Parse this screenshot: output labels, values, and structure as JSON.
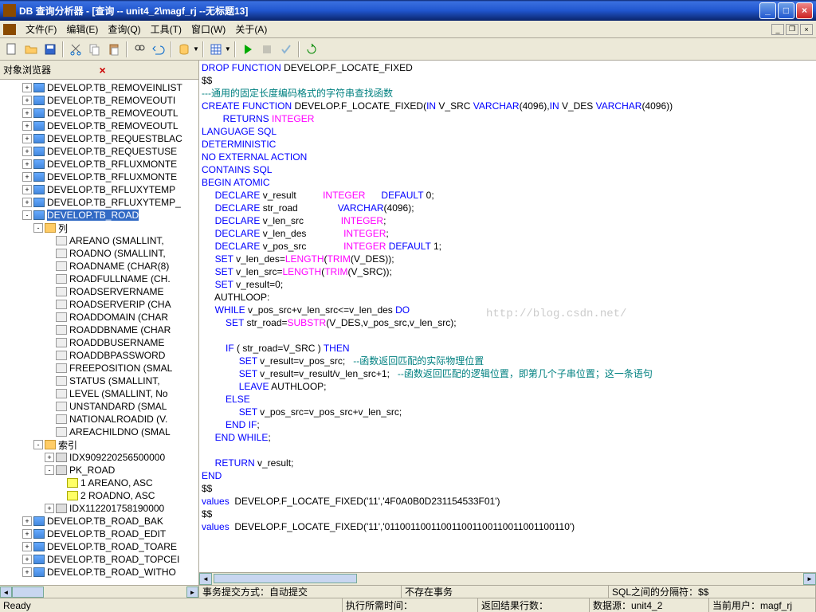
{
  "window": {
    "title": "DB 查询分析器 - [查询 -- unit4_2\\magf_rj  --无标题13]"
  },
  "menu": {
    "file": "文件(F)",
    "edit": "编辑(E)",
    "query": "查询(Q)",
    "tools": "工具(T)",
    "window": "窗口(W)",
    "help": "关于(A)"
  },
  "sidebar": {
    "title": "对象浏览器",
    "nodes": [
      {
        "l": 2,
        "e": "+",
        "i": "table",
        "t": "DEVELOP.TB_REMOVEINLIST"
      },
      {
        "l": 2,
        "e": "+",
        "i": "table",
        "t": "DEVELOP.TB_REMOVEOUTI"
      },
      {
        "l": 2,
        "e": "+",
        "i": "table",
        "t": "DEVELOP.TB_REMOVEOUTL"
      },
      {
        "l": 2,
        "e": "+",
        "i": "table",
        "t": "DEVELOP.TB_REMOVEOUTL"
      },
      {
        "l": 2,
        "e": "+",
        "i": "table",
        "t": "DEVELOP.TB_REQUESTBLAC"
      },
      {
        "l": 2,
        "e": "+",
        "i": "table",
        "t": "DEVELOP.TB_REQUESTUSE"
      },
      {
        "l": 2,
        "e": "+",
        "i": "table",
        "t": "DEVELOP.TB_RFLUXMONTE"
      },
      {
        "l": 2,
        "e": "+",
        "i": "table",
        "t": "DEVELOP.TB_RFLUXMONTE"
      },
      {
        "l": 2,
        "e": "+",
        "i": "table",
        "t": "DEVELOP.TB_RFLUXYTEMP"
      },
      {
        "l": 2,
        "e": "+",
        "i": "table",
        "t": "DEVELOP.TB_RFLUXYTEMP_"
      },
      {
        "l": 2,
        "e": "-",
        "i": "table",
        "t": "DEVELOP.TB_ROAD",
        "sel": true
      },
      {
        "l": 3,
        "e": "-",
        "i": "folder",
        "t": "列"
      },
      {
        "l": 4,
        "e": " ",
        "i": "col",
        "t": "AREANO (SMALLINT,"
      },
      {
        "l": 4,
        "e": " ",
        "i": "col",
        "t": "ROADNO (SMALLINT,"
      },
      {
        "l": 4,
        "e": " ",
        "i": "col",
        "t": "ROADNAME (CHAR(8)"
      },
      {
        "l": 4,
        "e": " ",
        "i": "col",
        "t": "ROADFULLNAME (CH."
      },
      {
        "l": 4,
        "e": " ",
        "i": "col",
        "t": "ROADSERVERNAME"
      },
      {
        "l": 4,
        "e": " ",
        "i": "col",
        "t": "ROADSERVERIP (CHA"
      },
      {
        "l": 4,
        "e": " ",
        "i": "col",
        "t": "ROADDOMAIN (CHAR"
      },
      {
        "l": 4,
        "e": " ",
        "i": "col",
        "t": "ROADDBNAME (CHAR"
      },
      {
        "l": 4,
        "e": " ",
        "i": "col",
        "t": "ROADDBUSERNAME"
      },
      {
        "l": 4,
        "e": " ",
        "i": "col",
        "t": "ROADDBPASSWORD"
      },
      {
        "l": 4,
        "e": " ",
        "i": "col",
        "t": "FREEPOSITION (SMAL"
      },
      {
        "l": 4,
        "e": " ",
        "i": "col",
        "t": "STATUS (SMALLINT,"
      },
      {
        "l": 4,
        "e": " ",
        "i": "col",
        "t": "LEVEL (SMALLINT, No"
      },
      {
        "l": 4,
        "e": " ",
        "i": "col",
        "t": "UNSTANDARD (SMAL"
      },
      {
        "l": 4,
        "e": " ",
        "i": "col",
        "t": "NATIONALROADID (V."
      },
      {
        "l": 4,
        "e": " ",
        "i": "col",
        "t": "AREACHILDNO (SMAL"
      },
      {
        "l": 3,
        "e": "-",
        "i": "folder",
        "t": "索引"
      },
      {
        "l": 4,
        "e": "+",
        "i": "idx",
        "t": "IDX909220256500000"
      },
      {
        "l": 4,
        "e": "-",
        "i": "idx",
        "t": "PK_ROAD"
      },
      {
        "l": 5,
        "e": " ",
        "i": "key",
        "t": "1 AREANO, ASC"
      },
      {
        "l": 5,
        "e": " ",
        "i": "key",
        "t": "2 ROADNO, ASC"
      },
      {
        "l": 4,
        "e": "+",
        "i": "idx",
        "t": "IDX112201758190000"
      },
      {
        "l": 2,
        "e": "+",
        "i": "table",
        "t": "DEVELOP.TB_ROAD_BAK"
      },
      {
        "l": 2,
        "e": "+",
        "i": "table",
        "t": "DEVELOP.TB_ROAD_EDIT"
      },
      {
        "l": 2,
        "e": "+",
        "i": "table",
        "t": "DEVELOP.TB_ROAD_TOARE"
      },
      {
        "l": 2,
        "e": "+",
        "i": "table",
        "t": "DEVELOP.TB_ROAD_TOPCEI"
      },
      {
        "l": 2,
        "e": "+",
        "i": "table",
        "t": "DEVELOP.TB_ROAD_WITHO"
      }
    ]
  },
  "code_lines": [
    [
      [
        "kw",
        "DROP"
      ],
      [
        "b",
        " "
      ],
      [
        "kw",
        "FUNCTION"
      ],
      [
        "b",
        " DEVELOP.F_LOCATE_FIXED"
      ]
    ],
    [
      [
        "b",
        "$$"
      ]
    ],
    [
      [
        "cm",
        "---通用的固定长度编码格式的字符串查找函数"
      ]
    ],
    [
      [
        "kw",
        "CREATE"
      ],
      [
        "b",
        " "
      ],
      [
        "kw",
        "FUNCTION"
      ],
      [
        "b",
        " DEVELOP.F_LOCATE_FIXED("
      ],
      [
        "kw",
        "IN"
      ],
      [
        "b",
        " V_SRC "
      ],
      [
        "kw",
        "VARCHAR"
      ],
      [
        "b",
        "(4096),"
      ],
      [
        "kw",
        "IN"
      ],
      [
        "b",
        " V_DES "
      ],
      [
        "kw",
        "VARCHAR"
      ],
      [
        "b",
        "(4096))"
      ]
    ],
    [
      [
        "b",
        "        "
      ],
      [
        "kw",
        "RETURNS"
      ],
      [
        "b",
        " "
      ],
      [
        "fn",
        "INTEGER"
      ]
    ],
    [
      [
        "kw",
        "LANGUAGE"
      ],
      [
        "b",
        " "
      ],
      [
        "kw",
        "SQL"
      ]
    ],
    [
      [
        "kw",
        "DETERMINISTIC"
      ]
    ],
    [
      [
        "kw",
        "NO"
      ],
      [
        "b",
        " "
      ],
      [
        "kw",
        "EXTERNAL"
      ],
      [
        "b",
        " "
      ],
      [
        "kw",
        "ACTION"
      ]
    ],
    [
      [
        "kw",
        "CONTAINS"
      ],
      [
        "b",
        " "
      ],
      [
        "kw",
        "SQL"
      ]
    ],
    [
      [
        "kw",
        "BEGIN"
      ],
      [
        "b",
        " "
      ],
      [
        "kw",
        "ATOMIC"
      ]
    ],
    [
      [
        "b",
        "     "
      ],
      [
        "kw",
        "DECLARE"
      ],
      [
        "b",
        " v_result          "
      ],
      [
        "fn",
        "INTEGER"
      ],
      [
        "b",
        "      "
      ],
      [
        "kw",
        "DEFAULT"
      ],
      [
        "b",
        " 0;"
      ]
    ],
    [
      [
        "b",
        "     "
      ],
      [
        "kw",
        "DECLARE"
      ],
      [
        "b",
        " str_road               "
      ],
      [
        "kw",
        "VARCHAR"
      ],
      [
        "b",
        "(4096);"
      ]
    ],
    [
      [
        "b",
        "     "
      ],
      [
        "kw",
        "DECLARE"
      ],
      [
        "b",
        " v_len_src              "
      ],
      [
        "fn",
        "INTEGER"
      ],
      [
        "b",
        ";"
      ]
    ],
    [
      [
        "b",
        "     "
      ],
      [
        "kw",
        "DECLARE"
      ],
      [
        "b",
        " v_len_des              "
      ],
      [
        "fn",
        "INTEGER"
      ],
      [
        "b",
        ";"
      ]
    ],
    [
      [
        "b",
        "     "
      ],
      [
        "kw",
        "DECLARE"
      ],
      [
        "b",
        " v_pos_src              "
      ],
      [
        "fn",
        "INTEGER"
      ],
      [
        "b",
        " "
      ],
      [
        "kw",
        "DEFAULT"
      ],
      [
        "b",
        " 1;"
      ]
    ],
    [
      [
        "b",
        "     "
      ],
      [
        "kw",
        "SET"
      ],
      [
        "b",
        " v_len_des="
      ],
      [
        "fn",
        "LENGTH"
      ],
      [
        "b",
        "("
      ],
      [
        "fn",
        "TRIM"
      ],
      [
        "b",
        "(V_DES));"
      ]
    ],
    [
      [
        "b",
        "     "
      ],
      [
        "kw",
        "SET"
      ],
      [
        "b",
        " v_len_src="
      ],
      [
        "fn",
        "LENGTH"
      ],
      [
        "b",
        "("
      ],
      [
        "fn",
        "TRIM"
      ],
      [
        "b",
        "(V_SRC));"
      ]
    ],
    [
      [
        "b",
        "     "
      ],
      [
        "kw",
        "SET"
      ],
      [
        "b",
        " v_result=0;"
      ]
    ],
    [
      [
        "b",
        "     AUTHLOOP:"
      ]
    ],
    [
      [
        "b",
        "     "
      ],
      [
        "kw",
        "WHILE"
      ],
      [
        "b",
        " v_pos_src+v_len_src<=v_len_des "
      ],
      [
        "kw",
        "DO"
      ]
    ],
    [
      [
        "b",
        "         "
      ],
      [
        "kw",
        "SET"
      ],
      [
        "b",
        " str_road="
      ],
      [
        "fn",
        "SUBSTR"
      ],
      [
        "b",
        "(V_DES,v_pos_src,v_len_src);"
      ]
    ],
    [
      [
        "b",
        ""
      ]
    ],
    [
      [
        "b",
        "         "
      ],
      [
        "kw",
        "IF"
      ],
      [
        "b",
        " ( str_road=V_SRC ) "
      ],
      [
        "kw",
        "THEN"
      ]
    ],
    [
      [
        "b",
        "              "
      ],
      [
        "kw",
        "SET"
      ],
      [
        "b",
        " v_result=v_pos_src;   "
      ],
      [
        "cm2",
        "--函数返回匹配的实际物理位置"
      ]
    ],
    [
      [
        "b",
        "              "
      ],
      [
        "kw",
        "SET"
      ],
      [
        "b",
        " v_result=v_result/v_len_src+1;   "
      ],
      [
        "cm2",
        "--函数返回匹配的逻辑位置，即第几个子串位置；这一条语句"
      ]
    ],
    [
      [
        "b",
        "              "
      ],
      [
        "kw",
        "LEAVE"
      ],
      [
        "b",
        " AUTHLOOP;"
      ]
    ],
    [
      [
        "b",
        "         "
      ],
      [
        "kw",
        "ELSE"
      ]
    ],
    [
      [
        "b",
        "              "
      ],
      [
        "kw",
        "SET"
      ],
      [
        "b",
        " v_pos_src=v_pos_src+v_len_src;"
      ]
    ],
    [
      [
        "b",
        "         "
      ],
      [
        "kw",
        "END"
      ],
      [
        "b",
        " "
      ],
      [
        "kw",
        "IF"
      ],
      [
        "b",
        ";"
      ]
    ],
    [
      [
        "b",
        "     "
      ],
      [
        "kw",
        "END"
      ],
      [
        "b",
        " "
      ],
      [
        "kw",
        "WHILE"
      ],
      [
        "b",
        ";"
      ]
    ],
    [
      [
        "b",
        ""
      ]
    ],
    [
      [
        "b",
        "     "
      ],
      [
        "kw",
        "RETURN"
      ],
      [
        "b",
        " v_result;"
      ]
    ],
    [
      [
        "kw",
        "END"
      ]
    ],
    [
      [
        "b",
        "$$"
      ]
    ],
    [
      [
        "kw",
        "values"
      ],
      [
        "b",
        "  DEVELOP.F_LOCATE_FIXED('11','4F0A0B0D231154533F01')"
      ]
    ],
    [
      [
        "b",
        "$$"
      ]
    ],
    [
      [
        "kw",
        "values"
      ],
      [
        "b",
        "  DEVELOP.F_LOCATE_FIXED('11','011001100110011001100110011001100110')"
      ]
    ]
  ],
  "watermark": "http://blog.csdn.net/",
  "info1": {
    "a": "事务提交方式：自动提交",
    "b": "不存在事务",
    "c": "SQL之间的分隔符：$$"
  },
  "status": {
    "ready": "Ready",
    "exec": "执行所需时间：",
    "rows": "返回结果行数：",
    "ds": "数据源：unit4_2",
    "user": "当前用户：magf_rj"
  }
}
